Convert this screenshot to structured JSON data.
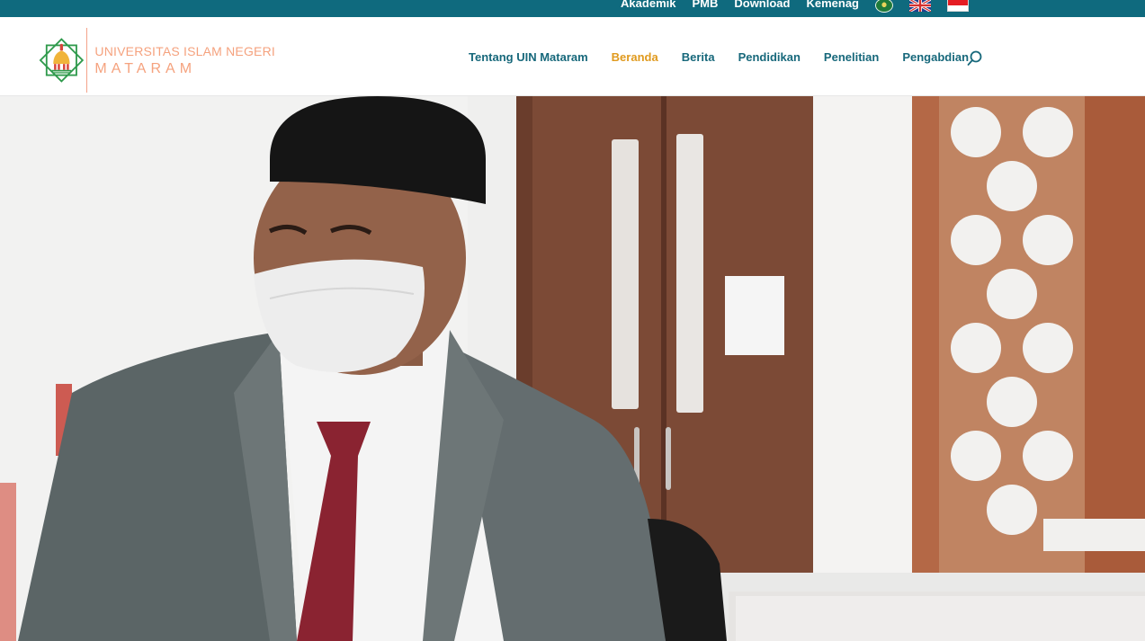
{
  "topbar": {
    "links": [
      "Akademik",
      "PMB",
      "Download",
      "Kemenag"
    ],
    "flags": [
      "kemenag-logo",
      "uk-flag",
      "indonesia-flag"
    ]
  },
  "logo": {
    "line1": "UNIVERSITAS ISLAM NEGERI",
    "line2": "MATARAM",
    "colors": {
      "green": "#2f9a4c",
      "orange": "#f5a27e",
      "red": "#d9453b",
      "gold": "#f0b43a"
    }
  },
  "nav": {
    "items": [
      {
        "label": "Tentang UIN Mataram",
        "active": false
      },
      {
        "label": "Beranda",
        "active": true
      },
      {
        "label": "Berita",
        "active": false
      },
      {
        "label": "Pendidikan",
        "active": false
      },
      {
        "label": "Penelitian",
        "active": false
      },
      {
        "label": "Pengabdian",
        "active": false
      }
    ],
    "search_icon": "search-icon"
  },
  "theme": {
    "topbar_bg": "#0f6a7e",
    "nav_color": "#17687b",
    "nav_active": "#e09a1e"
  }
}
